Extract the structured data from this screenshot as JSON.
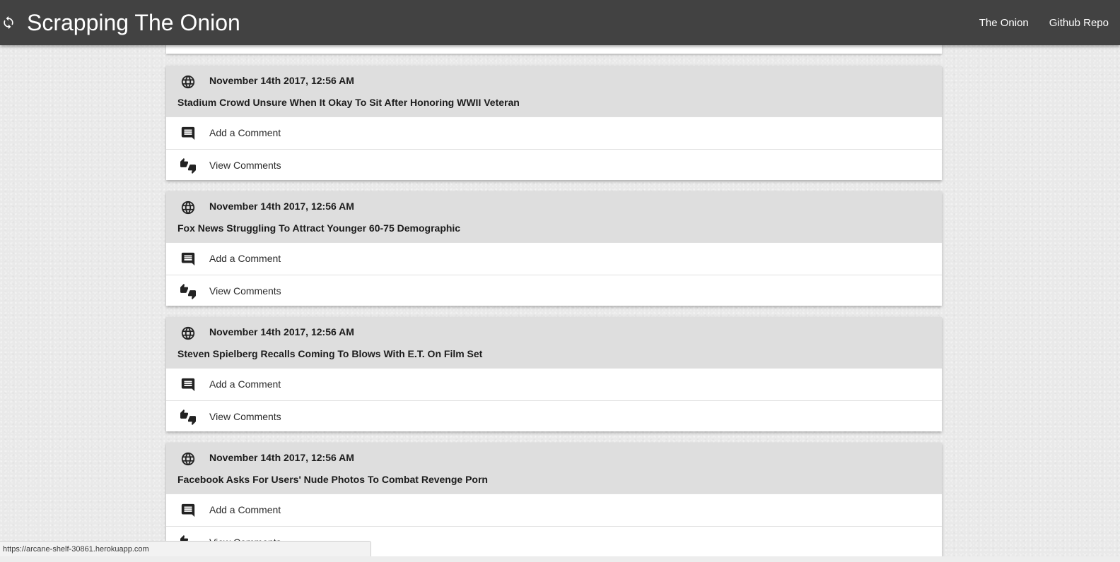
{
  "navbar": {
    "brand_icon": "sync-icon",
    "title": "Scrapping The Onion",
    "links": [
      "The Onion",
      "Github Repo"
    ]
  },
  "articles": [
    {
      "date": "November 14th 2017, 12:56 AM",
      "title": "Stadium Crowd Unsure When It Okay To Sit After Honoring WWII Veteran",
      "add_comment": "Add a Comment",
      "view_comments": "View Comments"
    },
    {
      "date": "November 14th 2017, 12:56 AM",
      "title": "Fox News Struggling To Attract Younger 60-75 Demographic",
      "add_comment": "Add a Comment",
      "view_comments": "View Comments"
    },
    {
      "date": "November 14th 2017, 12:56 AM",
      "title": "Steven Spielberg Recalls Coming To Blows With E.T. On Film Set",
      "add_comment": "Add a Comment",
      "view_comments": "View Comments"
    },
    {
      "date": "November 14th 2017, 12:56 AM",
      "title": "Facebook Asks For Users' Nude Photos To Combat Revenge Porn",
      "add_comment": "Add a Comment",
      "view_comments": "View Comments"
    }
  ],
  "icons": {
    "header": "globe-icon",
    "add_comment": "comment-icon",
    "view_comments": "thumbs-icon"
  },
  "status_url": "https://arcane-shelf-30861.herokuapp.com",
  "colors": {
    "navbar": "#424242",
    "card_header": "#dedede",
    "background": "#e9e9e9"
  }
}
